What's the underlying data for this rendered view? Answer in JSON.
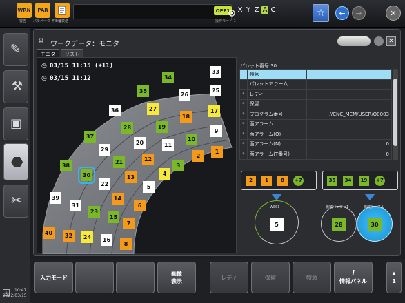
{
  "topbar": {
    "wrn_label": "WRN",
    "wrn_sub": "警告",
    "par_label": "PAR",
    "par_sub": "パラメータ 不一致",
    "doc_sub": "工程表送",
    "mode_label": "OPE1",
    "mode_sub": "操作モード 1",
    "axes": [
      "X",
      "Y",
      "Z",
      "A",
      "C"
    ],
    "axes_highlighted": [
      "A"
    ]
  },
  "window": {
    "title": "ワークデータ：モニタ",
    "tabs": [
      "モニタ",
      "リスト"
    ]
  },
  "monitor": {
    "time1": "03/15 11:15 (+11)",
    "time2": "03/15 11:12",
    "pallets": [
      {
        "id": "33",
        "color": "white"
      },
      {
        "id": "34",
        "color": "green"
      },
      {
        "id": "35",
        "color": "green"
      },
      {
        "id": "25",
        "color": "white"
      },
      {
        "id": "26",
        "color": "white"
      },
      {
        "id": "27",
        "color": "yellow"
      },
      {
        "id": "36",
        "color": "white"
      },
      {
        "id": "17",
        "color": "yellow"
      },
      {
        "id": "18",
        "color": "orange"
      },
      {
        "id": "19",
        "color": "green"
      },
      {
        "id": "28",
        "color": "green"
      },
      {
        "id": "9",
        "color": "white"
      },
      {
        "id": "10",
        "color": "green"
      },
      {
        "id": "37",
        "color": "green"
      },
      {
        "id": "20",
        "color": "white"
      },
      {
        "id": "11",
        "color": "white"
      },
      {
        "id": "29",
        "color": "white"
      },
      {
        "id": "1",
        "color": "orange"
      },
      {
        "id": "2",
        "color": "orange"
      },
      {
        "id": "12",
        "color": "orange"
      },
      {
        "id": "21",
        "color": "green"
      },
      {
        "id": "3",
        "color": "green"
      },
      {
        "id": "38",
        "color": "green"
      },
      {
        "id": "4",
        "color": "yellow"
      },
      {
        "id": "13",
        "color": "orange"
      },
      {
        "id": "30",
        "color": "green"
      },
      {
        "id": "22",
        "color": "white"
      },
      {
        "id": "5",
        "color": "white"
      },
      {
        "id": "14",
        "color": "orange"
      },
      {
        "id": "39",
        "color": "white"
      },
      {
        "id": "6",
        "color": "orange"
      },
      {
        "id": "31",
        "color": "white"
      },
      {
        "id": "23",
        "color": "green"
      },
      {
        "id": "15",
        "color": "green"
      },
      {
        "id": "7",
        "color": "orange"
      },
      {
        "id": "40",
        "color": "orange"
      },
      {
        "id": "32",
        "color": "orange"
      },
      {
        "id": "24",
        "color": "yellow"
      },
      {
        "id": "16",
        "color": "white"
      },
      {
        "id": "8",
        "color": "orange"
      }
    ],
    "highlighted_pallet": "30"
  },
  "details": {
    "pallet_number_label": "パレット番号 30",
    "rows": [
      {
        "mark": "",
        "label": "特急",
        "value": ""
      },
      {
        "mark": "",
        "label": "パレットアラーム",
        "value": ""
      },
      {
        "mark": "*",
        "label": "レディ",
        "value": ""
      },
      {
        "mark": "*",
        "label": "保留",
        "value": ""
      },
      {
        "mark": "*",
        "label": "プログラム番号",
        "value": "//CNC_MEM/USER/O0003"
      },
      {
        "mark": "*",
        "label": "面アラーム",
        "value": ""
      },
      {
        "mark": "*",
        "label": "面アラーム(O)",
        "value": ""
      },
      {
        "mark": "*",
        "label": "面アラーム(N)",
        "value": "0"
      },
      {
        "mark": "*",
        "label": "面アラーム(T番号)",
        "value": "0"
      }
    ]
  },
  "queues": {
    "left": {
      "items": [
        {
          "id": "2",
          "color": "orange"
        },
        {
          "id": "1",
          "color": "orange"
        },
        {
          "id": "8",
          "color": "orange"
        }
      ],
      "more": "+7"
    },
    "right": {
      "items": [
        {
          "id": "35",
          "color": "green"
        },
        {
          "id": "34",
          "color": "green"
        },
        {
          "id": "19",
          "color": "green"
        }
      ],
      "more": "+7"
    }
  },
  "stations": {
    "wss": {
      "label": "WSS1",
      "pallet": "5",
      "pallet_color": "white"
    },
    "buffer": {
      "label": "機械バッファ1",
      "pallet": "28",
      "pallet_color": "green"
    },
    "table": {
      "label": "機械テーブル",
      "pallet": "30",
      "pallet_color": "green"
    }
  },
  "softkeys": {
    "input_mode": "入力モード",
    "image_display": "画像\n表示",
    "ready": "レディ",
    "hold": "保留",
    "express": "特急",
    "info_panel": "情報パネル",
    "page": "1"
  },
  "clock": {
    "time": "10:47",
    "date": "2022/03/15"
  },
  "colors": {
    "white": "#ffffff",
    "green": "#7ab829",
    "yellow": "#f6e93a",
    "orange": "#f39a1b",
    "accent": "#36b4f0"
  }
}
